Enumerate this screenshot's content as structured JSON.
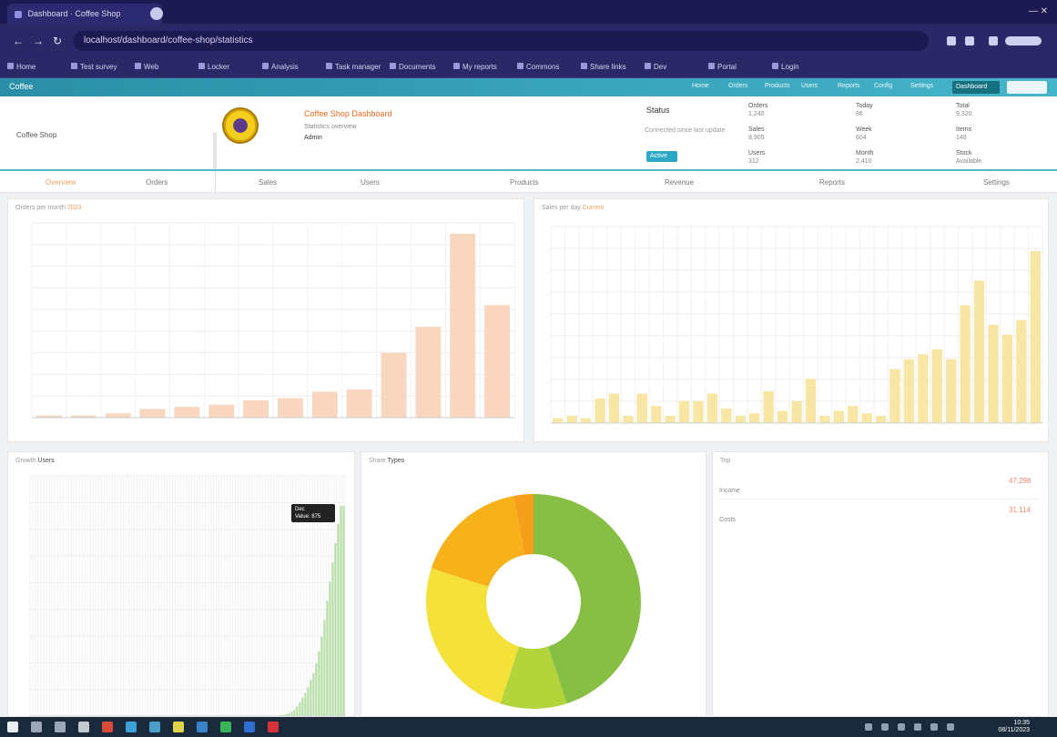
{
  "browser": {
    "tab_title": "Dashboard · Coffee Shop",
    "url": "localhost/dashboard/coffee-shop/statistics"
  },
  "bookmarks": [
    "Home",
    "Test survey",
    "Web",
    "Locker",
    "Analysis",
    "Task manager",
    "Documents",
    "My reports",
    "Commons",
    "Share links",
    "Dev",
    "Portal",
    "Login"
  ],
  "app": {
    "brand": "Coffee",
    "menu": [
      "Home",
      "Orders",
      "Products",
      "Users",
      "Reports",
      "Config",
      "Settings"
    ],
    "active_menu": "Dashboard"
  },
  "header": {
    "left_label": "Coffee Shop",
    "title": "Coffee Shop Dashboard",
    "subtitle": "Statistics overview",
    "subtitle2": "Admin",
    "status": "Status",
    "status_label": "Connected since last update",
    "badge": "Active",
    "stats": [
      [
        "Orders",
        "1,240",
        "Sales",
        "8,905",
        "Users",
        "312"
      ],
      [
        "Today",
        "86",
        "Week",
        "604",
        "Month",
        "2,410"
      ],
      [
        "Total",
        "9,320",
        "Items",
        "148",
        "Stock",
        "Available"
      ]
    ]
  },
  "tabs": [
    "Overview",
    "Orders",
    "Sales",
    "Users",
    "Products",
    "Revenue",
    "Reports",
    "Settings"
  ],
  "panels": {
    "p1_title": "Orders per month",
    "p1_hl": "2023",
    "p2_title": "Sales per day",
    "p2_hl": "Current",
    "p3_title": "Growth",
    "p3_hl": "Users",
    "p4_title": "Share",
    "p4_hl": "Types",
    "p5_title": "Top",
    "tooltip_title": "Dec",
    "tooltip_value": "Value: 875",
    "list": [
      {
        "label": "Income",
        "value": "47,298"
      },
      {
        "label": "Costs",
        "value": "31,114"
      }
    ]
  },
  "chart_data": [
    {
      "type": "bar",
      "values": [
        1,
        1,
        2,
        4,
        5,
        6,
        8,
        9,
        12,
        13,
        30,
        42,
        85,
        52
      ],
      "ylim": [
        0,
        90
      ],
      "color": "#f8d6bf"
    },
    {
      "type": "bar",
      "values": [
        2,
        3,
        2,
        10,
        12,
        3,
        12,
        7,
        3,
        9,
        9,
        12,
        6,
        3,
        4,
        13,
        5,
        9,
        18,
        3,
        5,
        7,
        4,
        3,
        22,
        26,
        28,
        30,
        26,
        48,
        58,
        40,
        36,
        42,
        70
      ],
      "ylim": [
        0,
        80
      ],
      "color": "#f8e7a4"
    },
    {
      "type": "bar",
      "values": [
        0,
        0,
        0,
        0,
        0,
        0,
        0,
        0,
        0,
        0,
        0,
        0,
        0,
        0,
        0,
        0,
        0,
        0,
        0,
        0,
        0,
        0,
        0,
        0,
        0,
        0,
        0,
        0,
        0,
        0,
        0,
        0,
        0,
        0,
        0,
        0,
        0,
        0,
        0,
        0,
        0,
        0,
        0,
        0,
        0,
        0,
        0,
        0,
        0,
        0,
        0,
        0,
        0,
        0,
        0,
        0,
        0,
        0,
        0,
        0,
        0,
        0,
        0,
        0,
        0,
        0,
        0,
        0,
        0,
        0,
        0,
        0,
        0,
        0,
        0,
        0,
        0,
        0,
        0,
        0,
        0,
        0,
        0,
        0,
        0,
        0,
        0,
        0,
        0,
        0,
        2,
        3,
        5,
        8,
        12,
        18,
        26,
        40,
        58,
        76,
        96,
        120,
        150,
        180,
        220,
        270,
        330,
        400,
        480,
        560,
        640,
        720,
        800,
        875,
        875
      ],
      "ylim": [
        0,
        1000
      ],
      "color": "#b4e0a4"
    },
    {
      "type": "pie",
      "values": [
        45,
        10,
        25,
        17,
        3
      ],
      "colors": [
        "#86bf44",
        "#b3d43a",
        "#f4e13a",
        "#f7b21a",
        "#f59f1a"
      ]
    }
  ],
  "taskbar": {
    "time": "10:35",
    "date": "08/11/2023"
  }
}
